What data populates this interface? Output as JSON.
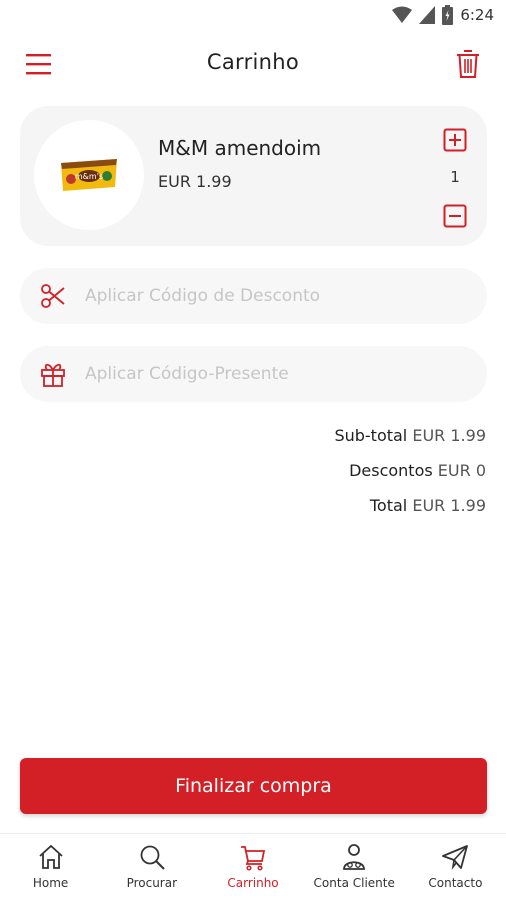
{
  "status_bar": {
    "time": "6:24"
  },
  "header": {
    "title": "Carrinho"
  },
  "cart": {
    "items": [
      {
        "name": "M&M amendoim",
        "price": "EUR 1.99",
        "quantity": "1",
        "thumb_text": "m&m's"
      }
    ]
  },
  "discount": {
    "placeholder": "Aplicar Código de Desconto"
  },
  "gift": {
    "placeholder": "Aplicar Código-Presente"
  },
  "totals": {
    "subtotal_label": "Sub-total",
    "subtotal_value": "EUR 1.99",
    "discount_label": "Descontos",
    "discount_value": "EUR 0",
    "total_label": "Total",
    "total_value": "EUR 1.99"
  },
  "checkout": {
    "label": "Finalizar compra"
  },
  "nav": {
    "items": [
      {
        "label": "Home",
        "icon": "home-icon"
      },
      {
        "label": "Procurar",
        "icon": "search-icon"
      },
      {
        "label": "Carrinho",
        "icon": "cart-icon"
      },
      {
        "label": "Conta Cliente",
        "icon": "account-icon"
      },
      {
        "label": "Contacto",
        "icon": "send-icon"
      }
    ],
    "active_index": 2
  },
  "colors": {
    "accent": "#d32027",
    "card_bg": "#f5f5f5",
    "placeholder": "#c6c6c6"
  }
}
